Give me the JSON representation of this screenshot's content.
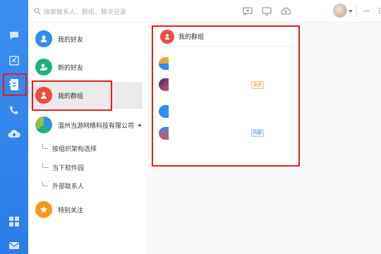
{
  "search": {
    "placeholder": "搜索联系人、群组、聊天记录"
  },
  "nav": {
    "items": [
      {
        "label": "我的好友"
      },
      {
        "label": "新的好友"
      },
      {
        "label": "我的群组"
      },
      {
        "label": "温州当游网络科技有限公司"
      },
      {
        "label": "特别关注"
      }
    ],
    "sub": [
      {
        "label": "按组织架构选择"
      },
      {
        "label": "当下软件园"
      },
      {
        "label": "外部联系人"
      }
    ]
  },
  "popup": {
    "title": "我的群组",
    "tags": {
      "all": "全员",
      "internal": "内部"
    }
  },
  "window": {
    "minimize": "—",
    "maximize": "▢",
    "close": "✕"
  },
  "colors": {
    "sidebar": "#3a8ff0",
    "friends": "#2f8ef0",
    "new_friends": "#22b07a",
    "groups": "#ea4d3d",
    "special": "#f39a1b",
    "highlight": "#e02020"
  }
}
